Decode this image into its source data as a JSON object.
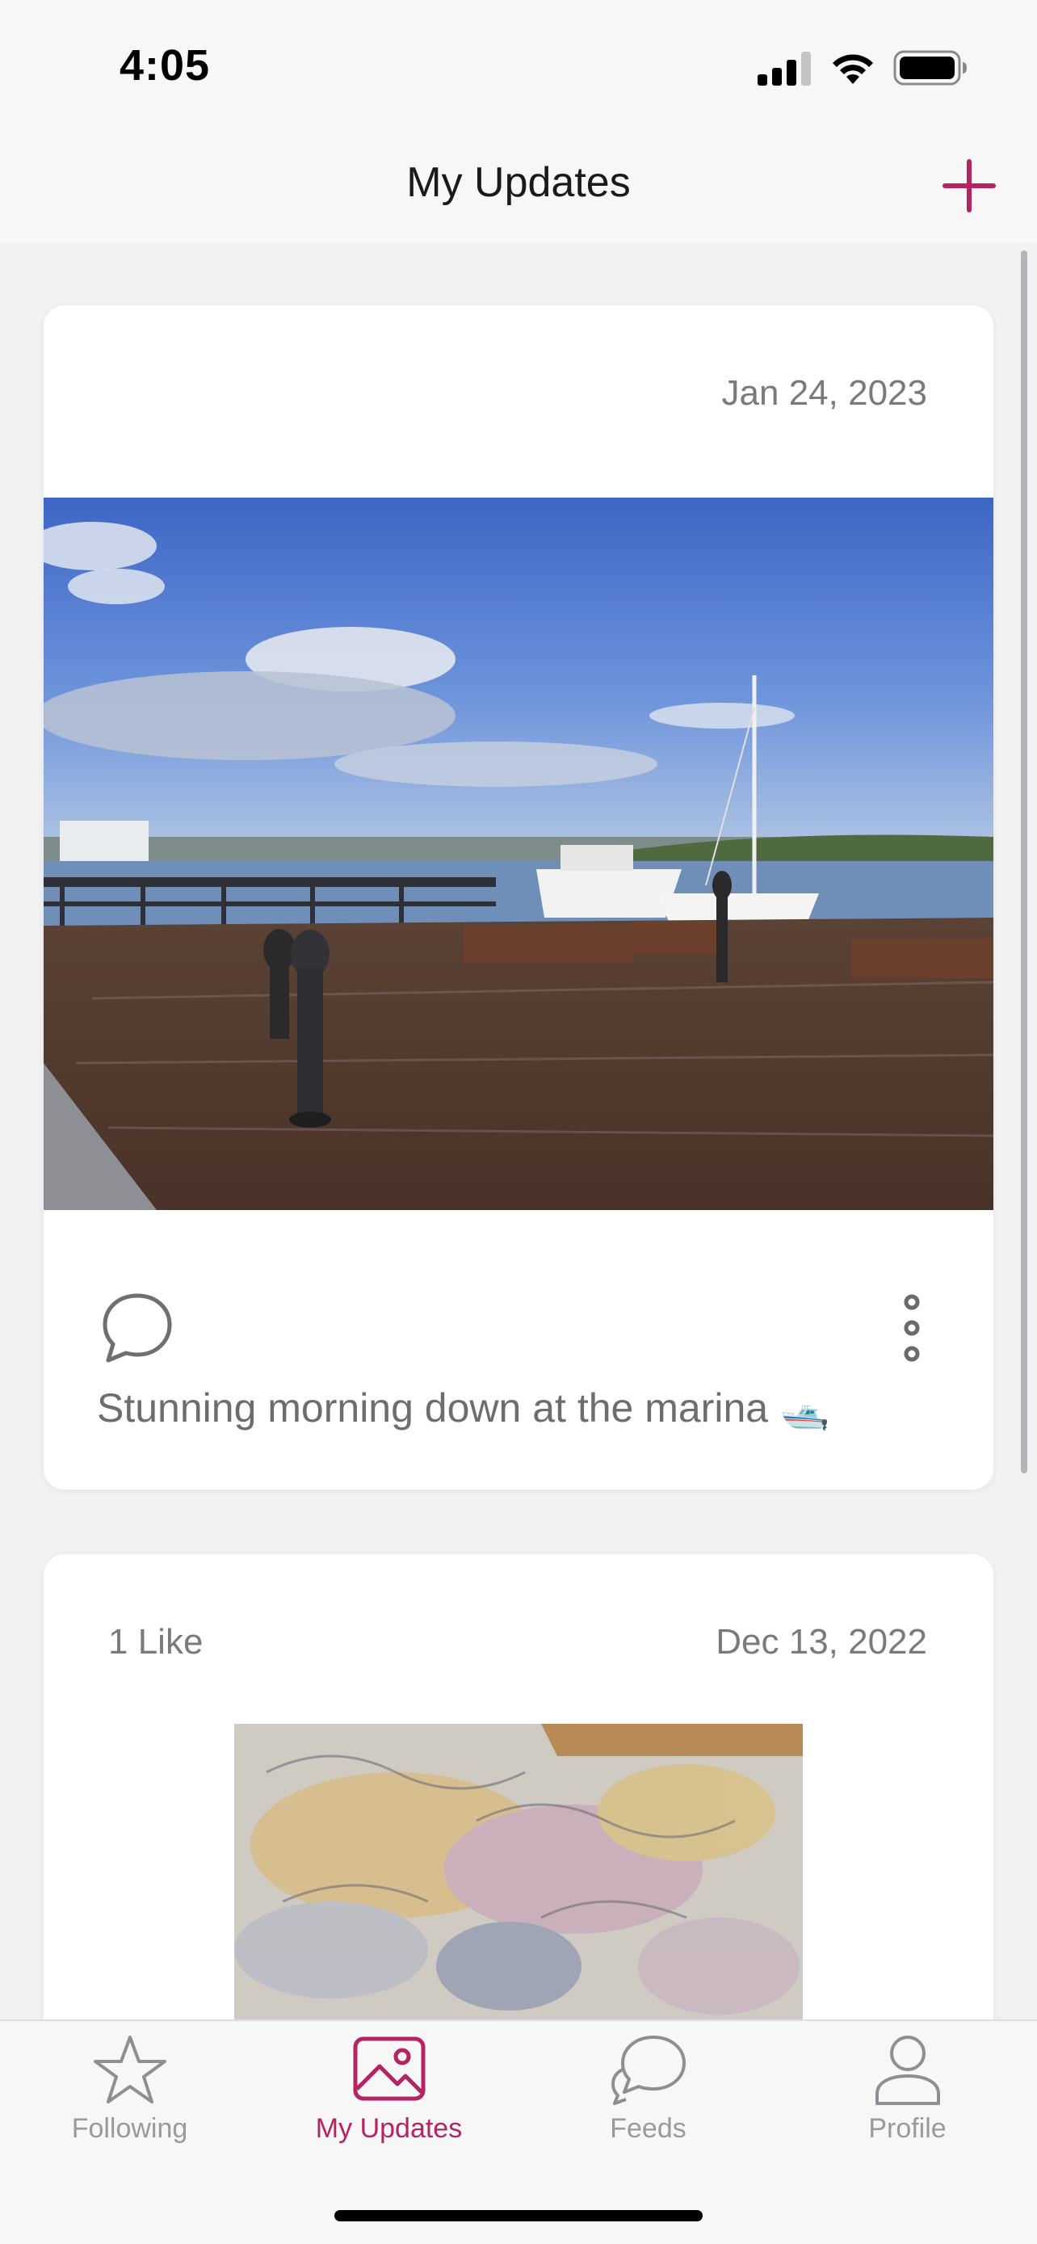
{
  "status_bar": {
    "time": "4:05",
    "icons": [
      "signal-icon",
      "wifi-icon",
      "battery-icon"
    ]
  },
  "nav": {
    "title": "My Updates",
    "add_icon": "plus-icon"
  },
  "accent_color": "#b5245f",
  "posts": [
    {
      "date": "Jan 24, 2023",
      "likes": "",
      "photo": "marina-photo",
      "caption": "Stunning morning down at the marina 🛥️",
      "icons": [
        "comment-icon",
        "more-vertical-icon"
      ]
    },
    {
      "date": "Dec 13, 2022",
      "likes": "1 Like",
      "photo": "rug-dog-photo"
    }
  ],
  "tabs": [
    {
      "label": "Following",
      "icon": "star-icon",
      "active": false
    },
    {
      "label": "My Updates",
      "icon": "image-icon",
      "active": true
    },
    {
      "label": "Feeds",
      "icon": "chat-bubbles-icon",
      "active": false
    },
    {
      "label": "Profile",
      "icon": "person-icon",
      "active": false
    }
  ]
}
